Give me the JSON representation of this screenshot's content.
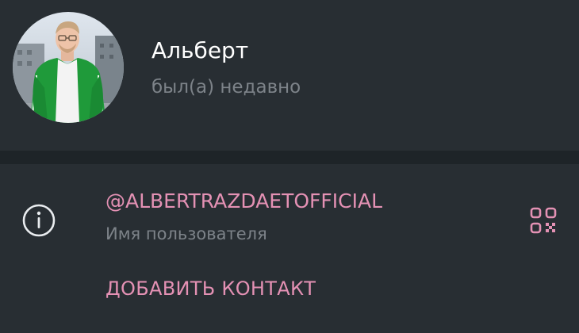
{
  "profile": {
    "name": "Альберт",
    "status": "был(а) недавно",
    "avatar_icon": "user-avatar-photo"
  },
  "info": {
    "info_icon": "info-circle-icon",
    "username": "@ALBERTRAZDAETOFFICIAL",
    "username_caption": "Имя пользователя",
    "qr_icon": "qr-code-icon"
  },
  "actions": {
    "add_contact_label": "ДОБАВИТЬ КОНТАКТ"
  },
  "colors": {
    "background": "#282e33",
    "divider": "#1e2428",
    "accent": "#e491b4",
    "secondary_text": "#7d8389",
    "primary_text": "#ffffff"
  }
}
